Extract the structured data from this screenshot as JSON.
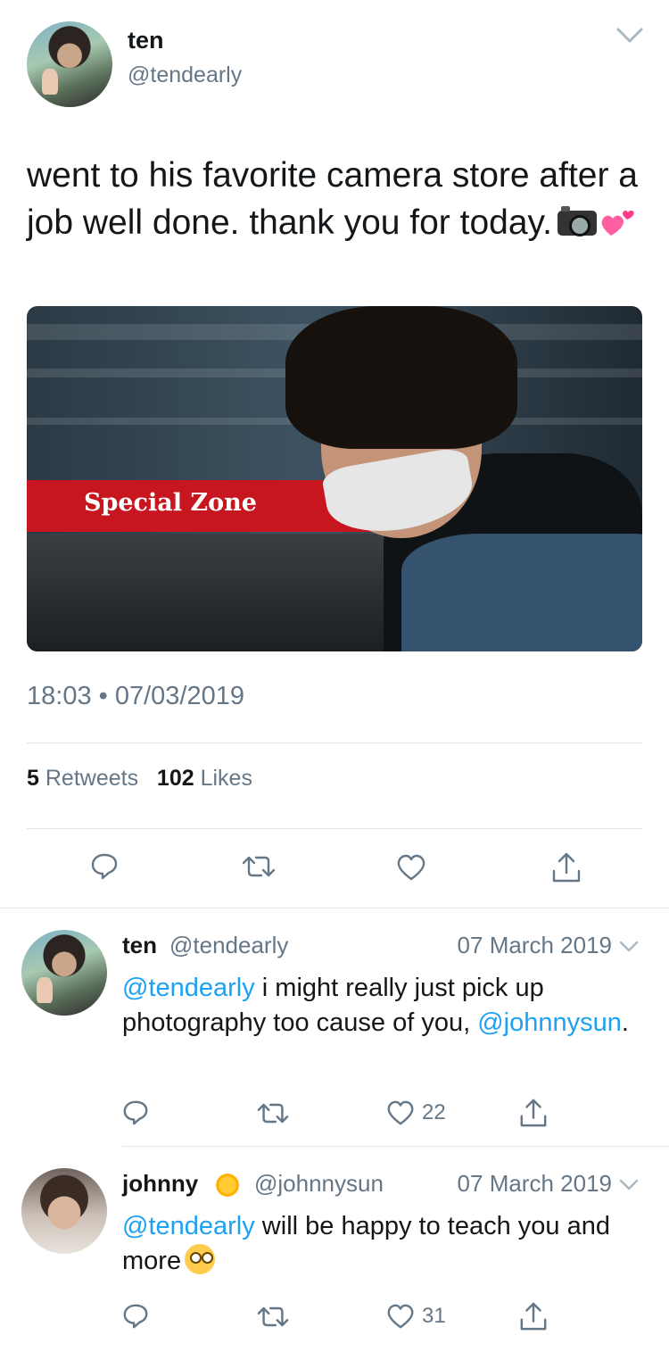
{
  "main_tweet": {
    "author_name": "ten",
    "author_handle": "@tendearly",
    "text": "went to his favorite camera store after a job well done. thank you for today.",
    "emojis": [
      "camera-with-flash-icon",
      "two-hearts-icon"
    ],
    "photo": {
      "banner_text": "Special Zone"
    },
    "timestamp": "18:03 • 07/03/2019",
    "retweets_count": "5",
    "retweets_label": "Retweets",
    "likes_count": "102",
    "likes_label": "Likes",
    "actions": [
      "reply-icon",
      "retweet-icon",
      "like-icon",
      "share-icon"
    ]
  },
  "replies": [
    {
      "author_name": "ten",
      "author_handle": "@tendearly",
      "date": "07 March 2019",
      "mention_1": "@tendearly",
      "text_1": " i might really just pick up photography too cause of you, ",
      "mention_2": "@johnnysun",
      "text_2": ".",
      "likes_count": "22"
    },
    {
      "author_name": "johnny",
      "author_handle": "@johnnysun",
      "name_emoji": "sun-with-face-icon",
      "date": "07 March 2019",
      "mention_1": "@tendearly",
      "text_1": " will be happy to teach you and more",
      "text_emoji": "flushed-face-icon",
      "likes_count": "31"
    }
  ],
  "colors": {
    "text": "#14171a",
    "secondary": "#657786",
    "link": "#1da1f2",
    "divider": "#e1e8ed",
    "banner_red": "#c7161f"
  }
}
